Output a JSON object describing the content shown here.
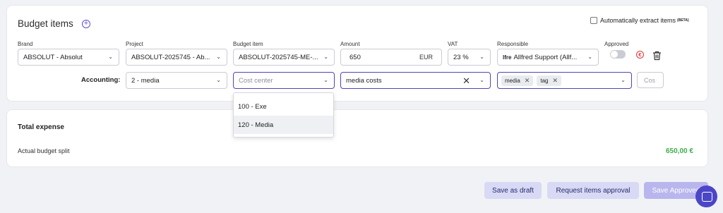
{
  "header": {
    "title": "Budget items",
    "auto_extract_label": "Automatically extract items",
    "beta_badge": "(BETA)"
  },
  "labels": {
    "brand": "Brand",
    "project": "Project",
    "budget_item": "Budget item",
    "amount": "Amount",
    "vat": "VAT",
    "responsible": "Responsible",
    "approved": "Approved",
    "accounting": "Accounting:"
  },
  "row": {
    "brand_value": "ABSOLUT - Absolut",
    "project_value": "ABSOLUT-2025745 - Ab...",
    "budget_item_value": "ABSOLUT-2025745-ME-...",
    "amount_value": "650",
    "currency": "EUR",
    "vat_value": "23 %",
    "responsible_prefix": "lfre",
    "responsible_value": "Allfred Support (Allf...",
    "approved": false
  },
  "accounting": {
    "category_value": "2 - media",
    "cost_center_placeholder": "Cost center",
    "description_value": "media costs",
    "tags": [
      "media",
      "tag"
    ],
    "cos_placeholder": "Cos"
  },
  "dropdown": {
    "options": [
      "100 - Exe",
      "120 - Media"
    ],
    "highlighted_index": 1
  },
  "summary": {
    "total_label": "Total expense",
    "split_label": "Actual budget split",
    "split_amount": "650,00 €"
  },
  "actions": {
    "save_draft": "Save as draft",
    "request_approval": "Request items approval",
    "save_approved": "Save Approved"
  },
  "colors": {
    "accent": "#4b46c6",
    "success": "#3fae4c",
    "danger": "#e33333"
  }
}
